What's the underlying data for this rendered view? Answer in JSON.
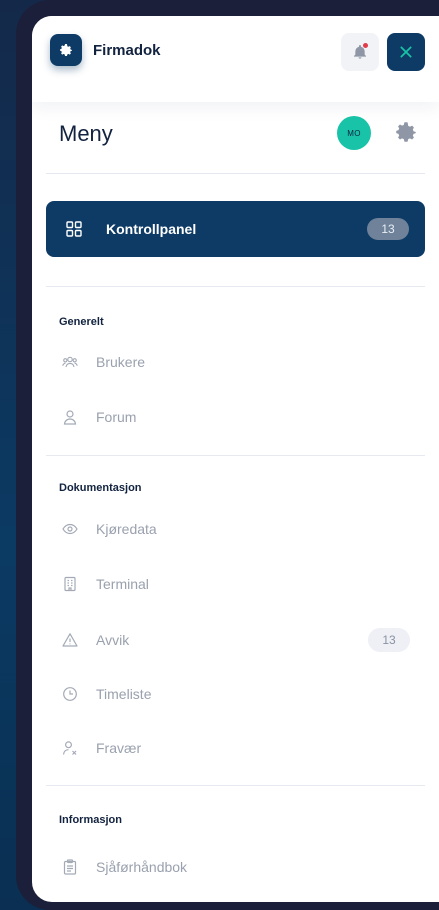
{
  "app": {
    "brand": "Firmadok"
  },
  "header": {
    "title": "Meny",
    "avatar_initials": "MO"
  },
  "active_item": {
    "label": "Kontrollpanel",
    "badge": "13",
    "icon": "grid-icon"
  },
  "sections": [
    {
      "title": "Generelt",
      "items": [
        {
          "label": "Brukere",
          "icon": "users-icon"
        },
        {
          "label": "Forum",
          "icon": "user-icon"
        }
      ]
    },
    {
      "title": "Dokumentasjon",
      "items": [
        {
          "label": "Kjøredata",
          "icon": "eye-icon"
        },
        {
          "label": "Terminal",
          "icon": "building-icon"
        },
        {
          "label": "Avvik",
          "icon": "warning-icon",
          "badge": "13"
        },
        {
          "label": "Timeliste",
          "icon": "clock-icon"
        },
        {
          "label": "Fravær",
          "icon": "user-x-icon"
        }
      ]
    },
    {
      "title": "Informasjon",
      "items": [
        {
          "label": "Sjåførhåndbok",
          "icon": "clipboard-icon"
        }
      ]
    }
  ],
  "colors": {
    "primary": "#0d3b66",
    "accent": "#19c3a8",
    "muted_text": "#9aa1ae",
    "notification": "#e23b4a"
  }
}
